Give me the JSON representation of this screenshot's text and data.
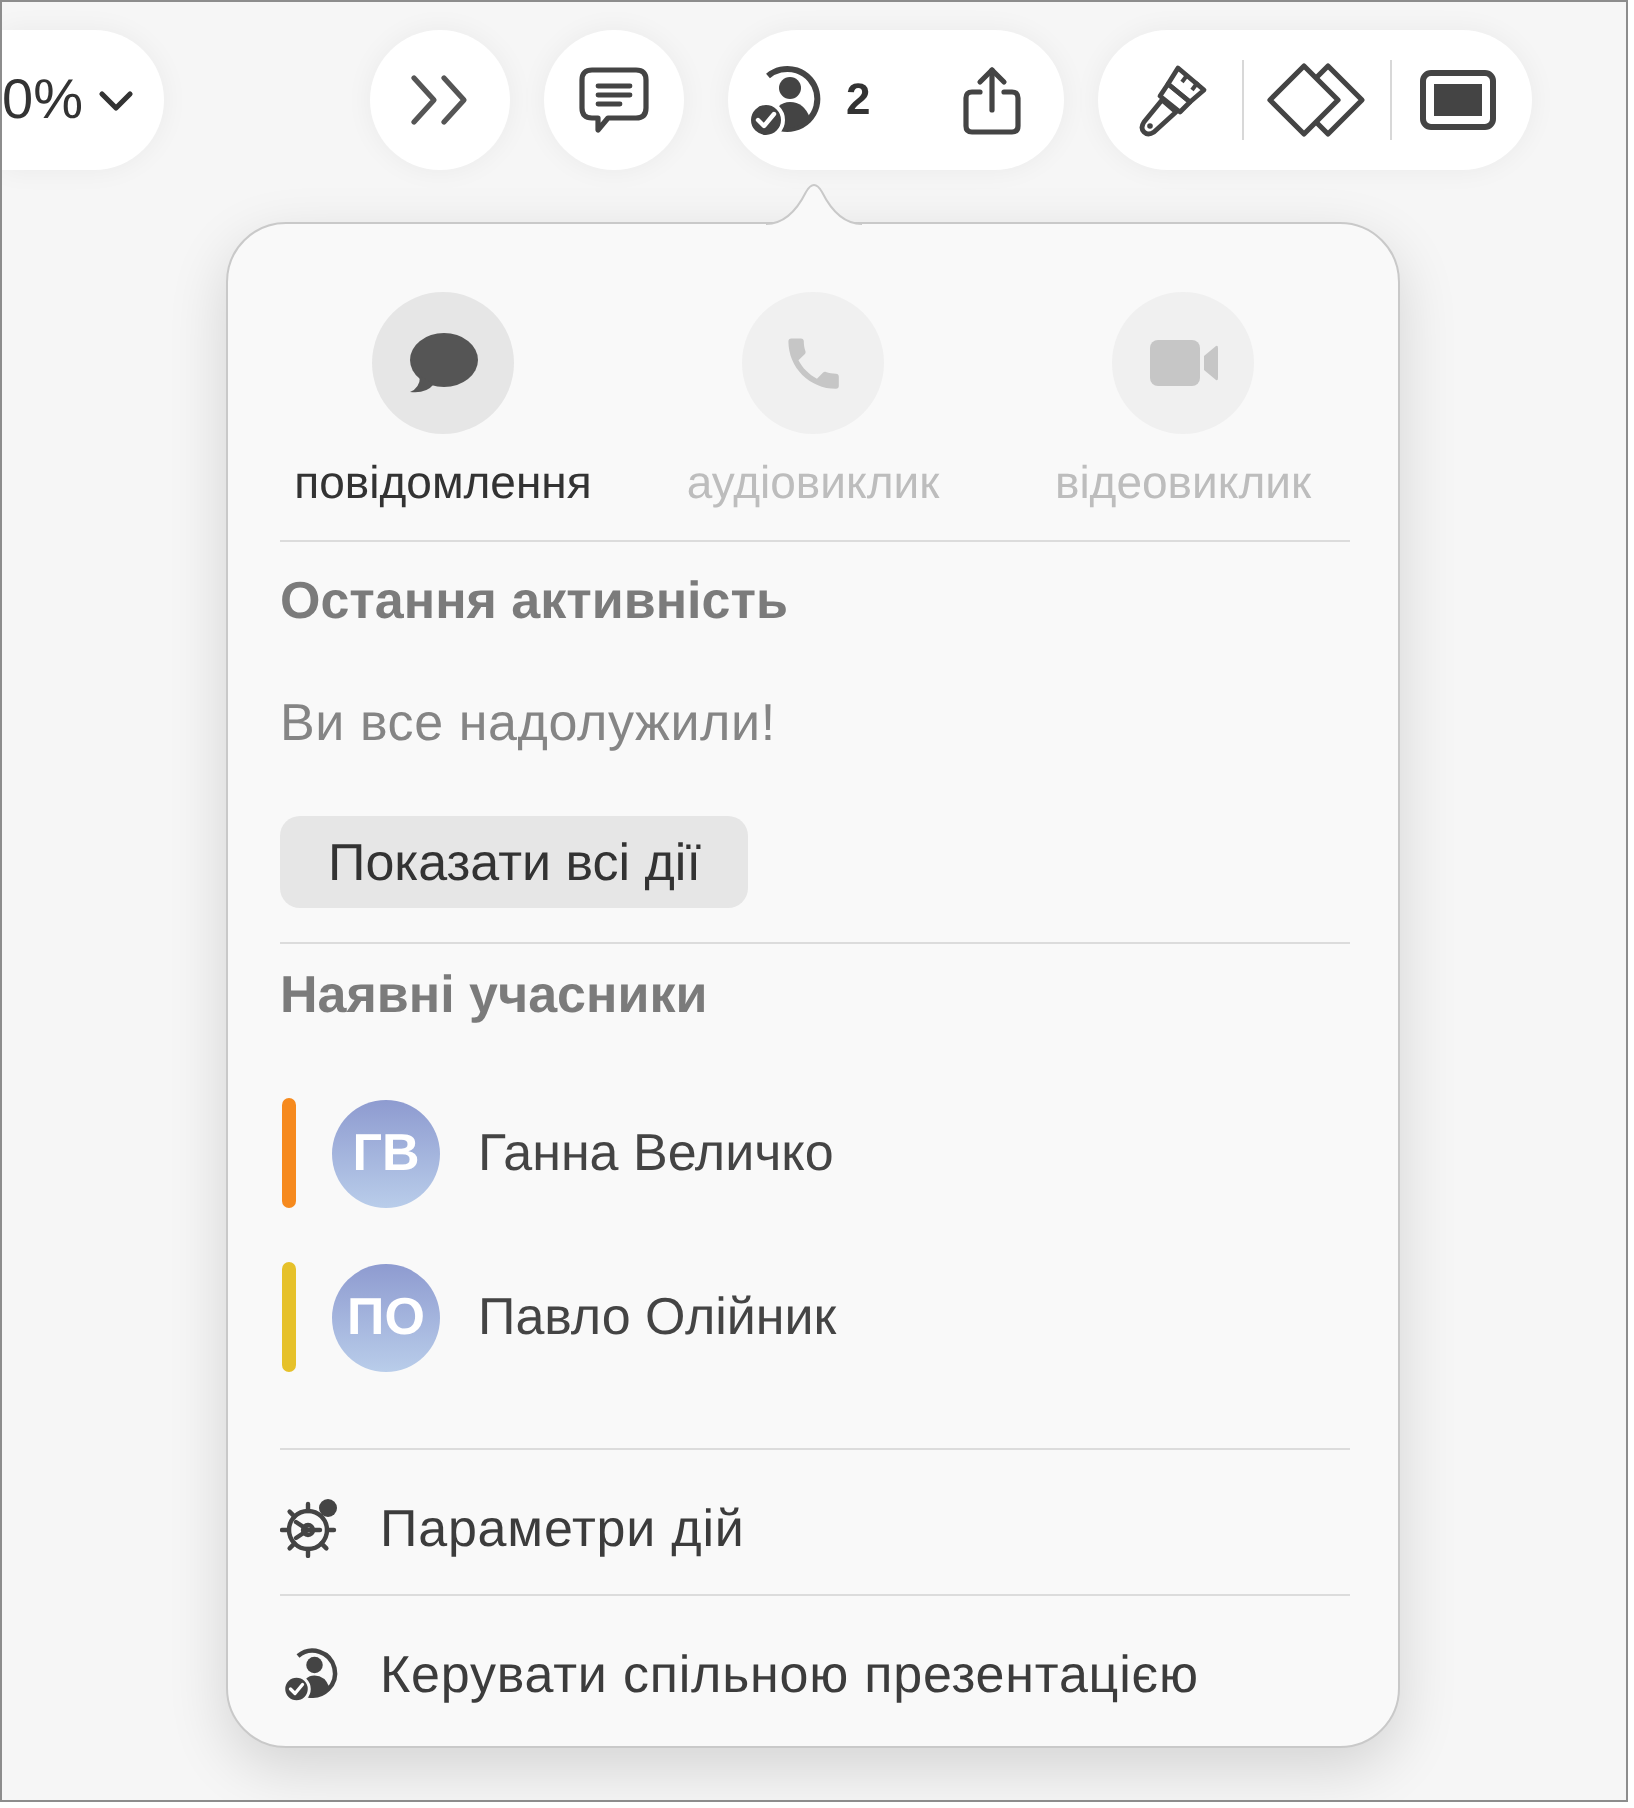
{
  "toolbar": {
    "zoom": {
      "value": "0%"
    },
    "collaborate": {
      "count": "2"
    }
  },
  "popover": {
    "actions": [
      {
        "kind": "message",
        "label": "повідомлення",
        "disabled": false
      },
      {
        "kind": "audio",
        "label": "аудіовиклик",
        "disabled": true
      },
      {
        "kind": "video",
        "label": "відеовиклик",
        "disabled": true
      }
    ],
    "recent_activity": {
      "heading": "Остання активність",
      "message": "Ви все надолужили!",
      "button": "Показати всі дії"
    },
    "participants": {
      "heading": "Наявні учасники",
      "items": [
        {
          "initials": "ГВ",
          "name": "Ганна Величко",
          "color": "#f68a1e"
        },
        {
          "initials": "ПО",
          "name": "Павло Олійник",
          "color": "#e6c12a"
        }
      ]
    },
    "menu": [
      {
        "kind": "settings",
        "label": "Параметри дій"
      },
      {
        "kind": "manage",
        "label": "Керувати спільною презентацією"
      }
    ]
  }
}
